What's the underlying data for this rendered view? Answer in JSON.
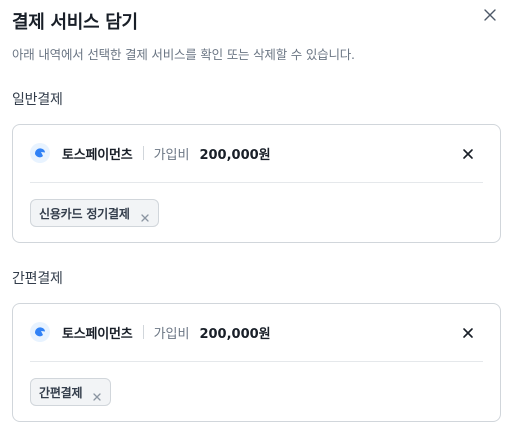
{
  "dialog": {
    "title": "결제 서비스 담기",
    "subtitle": "아래 내역에서 선택한 결제 서비스를 확인 또는 삭제할 수 있습니다."
  },
  "sections": [
    {
      "label": "일반결제",
      "provider": "토스페이먼츠",
      "fee_label": "가입비",
      "fee_value": "200,000원",
      "chips": [
        "신용카드 정기결제"
      ]
    },
    {
      "label": "간편결제",
      "provider": "토스페이먼츠",
      "fee_label": "가입비",
      "fee_value": "200,000원",
      "chips": [
        "간편결제"
      ]
    }
  ],
  "colors": {
    "accent": "#3182f6",
    "logo_bg": "#e8f3ff",
    "border": "#d1d6db",
    "chip_bg": "#f2f4f6"
  }
}
